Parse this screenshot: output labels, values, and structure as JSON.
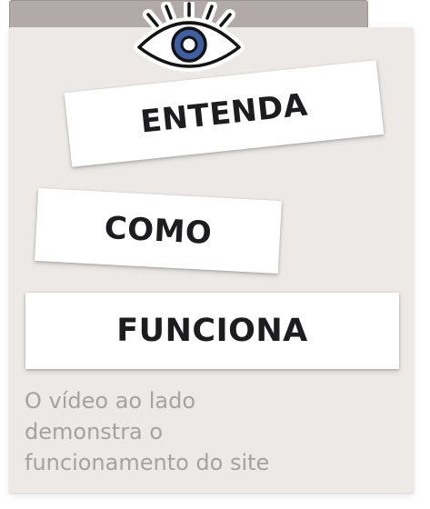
{
  "icon": {
    "name": "eye-icon",
    "iris_color": "#3f5fa3"
  },
  "notes": [
    {
      "label": "ENTENDA"
    },
    {
      "label": "COMO"
    },
    {
      "label": "FUNCIONA"
    }
  ],
  "caption": {
    "lines": [
      "O vídeo ao lado",
      "demonstra o",
      "funcionamento do site"
    ]
  },
  "colors": {
    "card_background": "#ece9e6",
    "tab_background": "#b2aaa8",
    "caption_text": "#a3a3a3",
    "note_text": "#1d1d1f"
  }
}
